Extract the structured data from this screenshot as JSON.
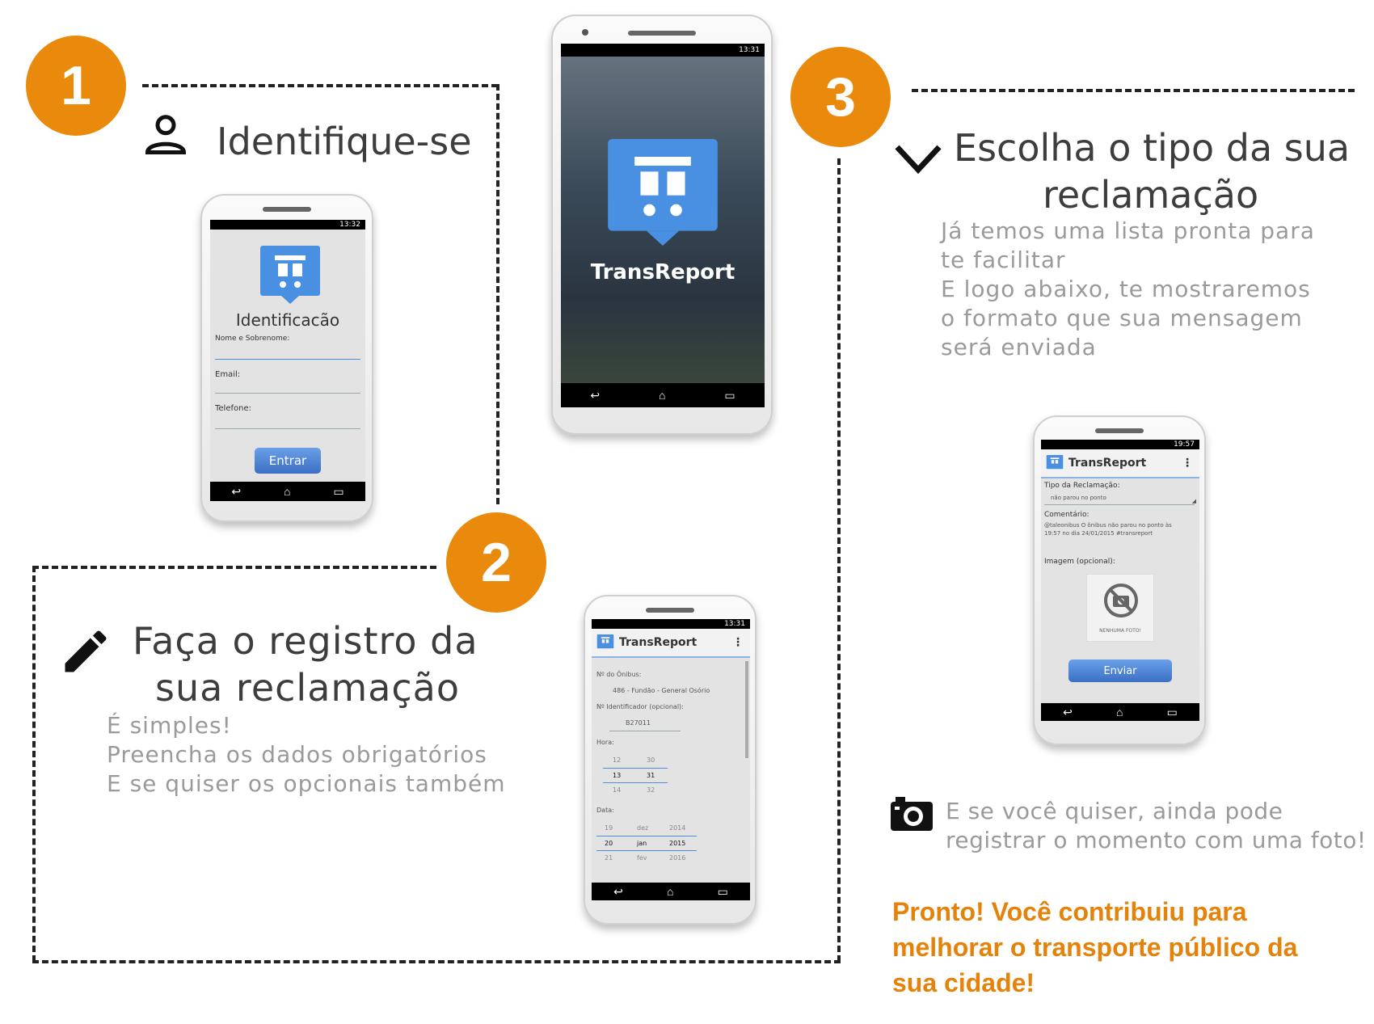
{
  "steps": {
    "one": {
      "number": "1",
      "title": "Identifique-se"
    },
    "two": {
      "number": "2",
      "title_line1": "Faça o registro da",
      "title_line2": "sua reclamação",
      "desc": [
        "É simples!",
        "Preencha os dados obrigatórios",
        "E se quiser os opcionais também"
      ]
    },
    "three": {
      "number": "3",
      "title_line1": "Escolha o tipo da sua",
      "title_line2": "reclamação",
      "desc": [
        "Já temos uma lista pronta para",
        "te facilitar",
        "E logo abaixo, te mostraremos",
        "o formato que sua mensagem",
        "será enviada"
      ]
    }
  },
  "camera": {
    "line1": "E se você quiser, ainda pode",
    "line2": "registrar o momento com uma foto!"
  },
  "final": {
    "line1": "Pronto! Você contribuiu para",
    "line2": "melhorar o transporte público da",
    "line3": "sua cidade!"
  },
  "splash": {
    "app_name": "TransReport",
    "time": "13:31"
  },
  "login": {
    "time": "13:32",
    "title": "Identificacão",
    "name_label": "Nome e Sobrenome:",
    "email_label": "Email:",
    "phone_label": "Telefone:",
    "submit": "Entrar"
  },
  "register": {
    "time": "13:31",
    "app_name": "TransReport",
    "bus_label": "Nº do Ônibus:",
    "bus_value": "486 - Fundão - General Osório",
    "id_label": "Nº Identificador (opcional):",
    "id_value": "B27011",
    "hour_label": "Hora:",
    "hours": [
      "12",
      "13",
      "14"
    ],
    "minutes": [
      "30",
      "31",
      "32"
    ],
    "date_label": "Data:",
    "days": [
      "19",
      "20",
      "21"
    ],
    "months": [
      "dez",
      "jan",
      "fev"
    ],
    "years": [
      "2014",
      "2015",
      "2016"
    ]
  },
  "complaint": {
    "time": "19:57",
    "app_name": "TransReport",
    "type_label": "Tipo da Reclamação:",
    "type_value": "não parou no ponto",
    "comment_label": "Comentário:",
    "comment_line1": "@taleonibus O ônibus  não parou no ponto às",
    "comment_line2": "19:57 no dia 24/01/2015  #transreport",
    "image_label": "Imagem (opcional):",
    "no_photo": "NENHUMA FOTO!",
    "submit": "Enviar"
  },
  "colors": {
    "accent": "#ea8a0c",
    "final_text": "#e5820a",
    "app_blue": "#4a90e2"
  }
}
